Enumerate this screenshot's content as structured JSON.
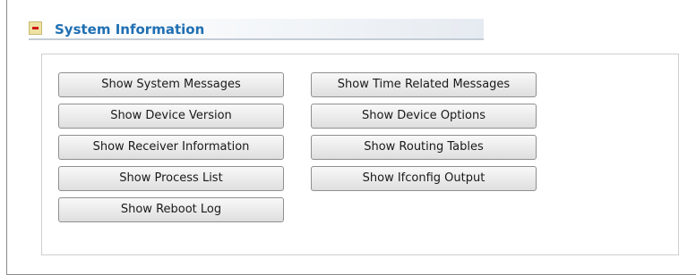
{
  "section": {
    "title": "System Information",
    "collapse_icon": "minus-icon"
  },
  "buttons": {
    "show_system_messages": "Show System Messages",
    "show_device_version": "Show Device Version",
    "show_receiver_information": "Show Receiver Information",
    "show_process_list": "Show Process List",
    "show_reboot_log": "Show Reboot Log",
    "show_time_related_messages": "Show Time Related Messages",
    "show_device_options": "Show Device Options",
    "show_routing_tables": "Show Routing Tables",
    "show_ifconfig_output": "Show Ifconfig Output"
  },
  "colors": {
    "title": "#1f6fb3",
    "collapse_icon_fill": "#ede2a3",
    "collapse_icon_bar": "#d01818"
  }
}
